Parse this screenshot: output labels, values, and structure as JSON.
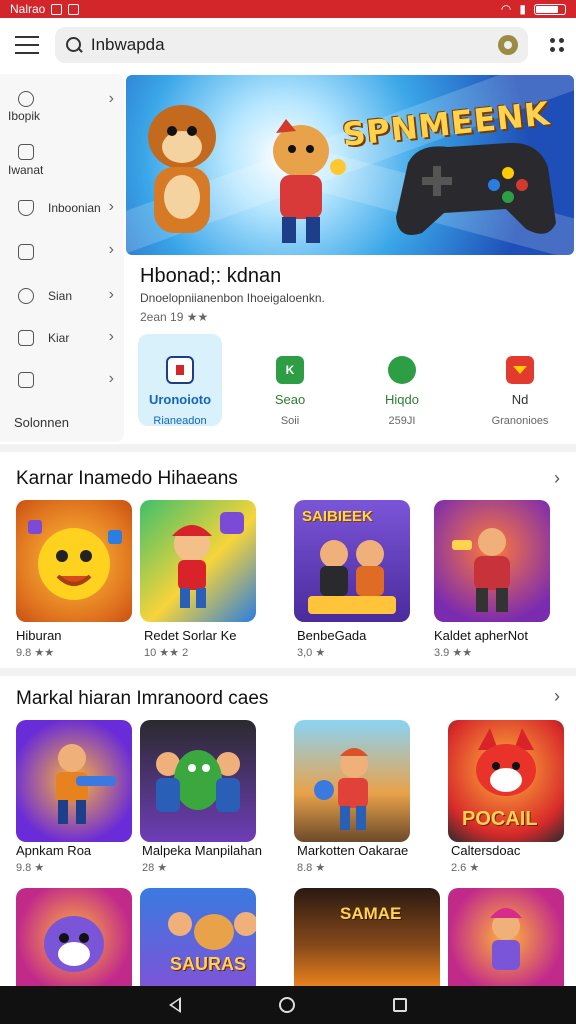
{
  "status_bar": {
    "carrier": "Nalrao"
  },
  "search": {
    "value": "Inbwapda"
  },
  "sidebar": {
    "items": [
      {
        "label": "Ibopik",
        "icon": "settings-icon"
      },
      {
        "label": "Iwanat",
        "icon": "device-icon"
      },
      {
        "label": "Inboonian",
        "icon": "shield-icon"
      },
      {
        "label": "",
        "icon": "store-icon"
      },
      {
        "label": "Sian",
        "icon": "gear-icon"
      },
      {
        "label": "Kiar",
        "icon": "calendar-icon"
      },
      {
        "label": "",
        "icon": "image-icon"
      }
    ],
    "footer": "Solonnen"
  },
  "hero": {
    "title": "SPNMEENK"
  },
  "featured_app": {
    "title": "Hbonad;: kdnan",
    "description": "Dnoelopniianenbon Ihoeigaloenkn.",
    "rating": "2ean 19 ★★"
  },
  "quick_actions": [
    {
      "label": "Uronoioto",
      "sub": "Rianeadon",
      "color": "#2aa6e0",
      "icon_text": ""
    },
    {
      "label": "Seao",
      "sub": "Soii",
      "color": "#2e9e45",
      "icon_text": "K"
    },
    {
      "label": "Hiqdo",
      "sub": "259JI",
      "color": "#2e9e45",
      "icon_text": ""
    },
    {
      "label": "Nd",
      "sub": "Granonioes",
      "color": "#e23a2f",
      "icon_text": ""
    }
  ],
  "section1": {
    "title": "Karnar Inamedo Hihaeans",
    "items": [
      {
        "name": "Hiburan",
        "meta": "9.8 ★★"
      },
      {
        "name": "Redet Sorlar Ke",
        "meta": "10 ★★ 2"
      },
      {
        "name": "BenbeGada",
        "meta": "3,0 ★"
      },
      {
        "name": "Kaldet apherNot",
        "meta": "3.9 ★★"
      }
    ],
    "tile_texts": [
      "",
      "",
      "SAIBIEEK",
      ""
    ]
  },
  "section2": {
    "title": "Markal hiaran Imranoord caes",
    "items": [
      {
        "name": "Apnkam Roa",
        "meta": "9.8 ★"
      },
      {
        "name": "Malpeka Manpilahan",
        "meta": "28 ★"
      },
      {
        "name": "Markotten Oakarae",
        "meta": "8.8 ★"
      },
      {
        "name": "Caltersdoac",
        "meta": "2.6 ★"
      }
    ],
    "tile_texts": [
      "",
      "",
      "",
      "POCAIL"
    ]
  },
  "section3": {
    "tile_texts": [
      "",
      "SAURAS",
      "SAMAE",
      ""
    ]
  },
  "colors": {
    "status_bar": "#d3262b",
    "accent_green": "#2e7d32"
  }
}
